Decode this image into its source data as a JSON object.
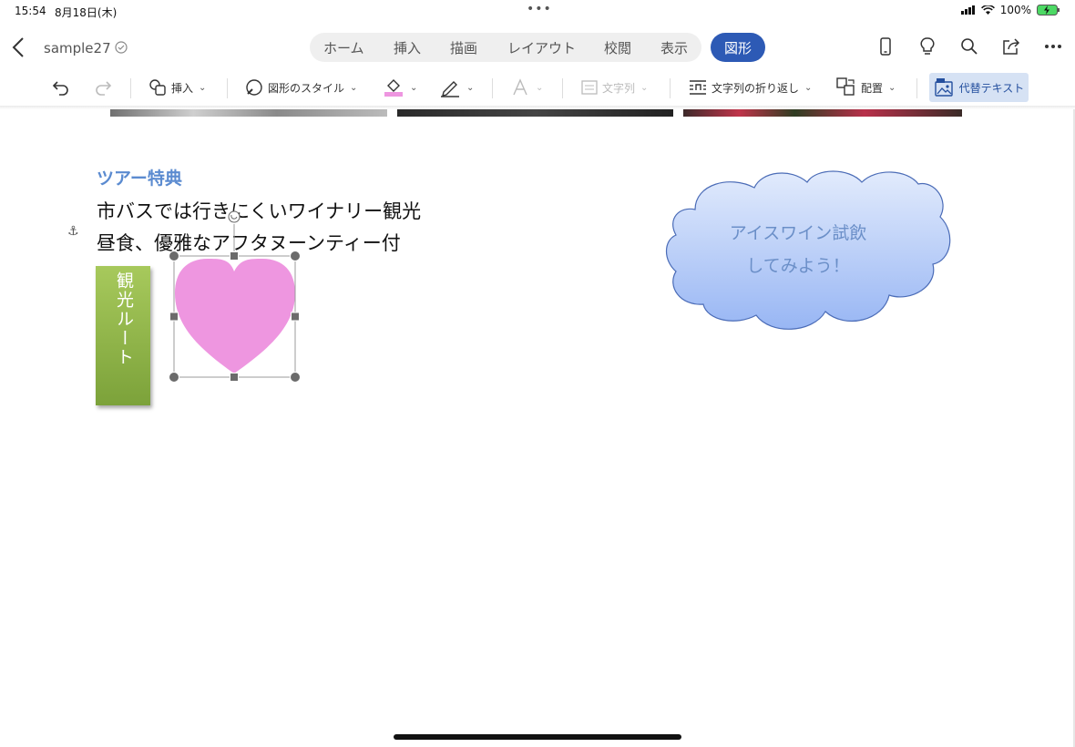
{
  "status_bar": {
    "time": "15:54",
    "date": "8月18日(木)",
    "dots": "•••",
    "battery": "100%"
  },
  "document": {
    "name": "sample27"
  },
  "tabs": [
    {
      "label": "ホーム"
    },
    {
      "label": "挿入"
    },
    {
      "label": "描画"
    },
    {
      "label": "レイアウト"
    },
    {
      "label": "校閲"
    },
    {
      "label": "表示"
    }
  ],
  "active_tab": "図形",
  "ribbon": {
    "insert": "挿入",
    "shape_style": "図形のスタイル",
    "text_direction": "文字列",
    "wrap_text": "文字列の折り返し",
    "arrange": "配置",
    "alt_text": "代替テキスト"
  },
  "content": {
    "heading": "ツアー特典",
    "line1": "市バスでは行きにくいワイナリー観光",
    "line2": "昼食、優雅なアフタヌーンティー付",
    "green_box": "観光ルート",
    "cloud_line1": "アイスワイン試飲",
    "cloud_line2": "してみよう！"
  },
  "colors": {
    "accent": "#2d5ab5",
    "heart": "#ee96e0",
    "heading": "#5b8bd0"
  }
}
